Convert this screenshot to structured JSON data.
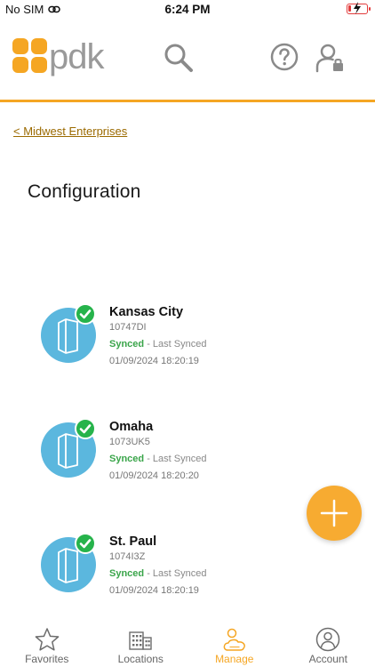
{
  "status_bar": {
    "carrier": "No SIM",
    "time": "6:24 PM"
  },
  "header": {
    "logo_text": "pdk",
    "accent_color": "#f5a623"
  },
  "breadcrumb": "< Midwest Enterprises",
  "page_title": "Configuration",
  "locations": [
    {
      "name": "Kansas City",
      "id": "10747DI",
      "status": "Synced",
      "status_suffix": " - Last Synced",
      "last_synced": "01/09/2024 18:20:19"
    },
    {
      "name": "Omaha",
      "id": "1073UK5",
      "status": "Synced",
      "status_suffix": " - Last Synced",
      "last_synced": "01/09/2024 18:20:20"
    },
    {
      "name": "St. Paul",
      "id": "1074I3Z",
      "status": "Synced",
      "status_suffix": " - Last Synced",
      "last_synced": "01/09/2024 18:20:19"
    }
  ],
  "tabs": [
    {
      "label": "Favorites",
      "icon": "star-icon"
    },
    {
      "label": "Locations",
      "icon": "building-icon"
    },
    {
      "label": "Manage",
      "icon": "manage-user-cloud-icon",
      "active": true
    },
    {
      "label": "Account",
      "icon": "account-icon"
    }
  ]
}
